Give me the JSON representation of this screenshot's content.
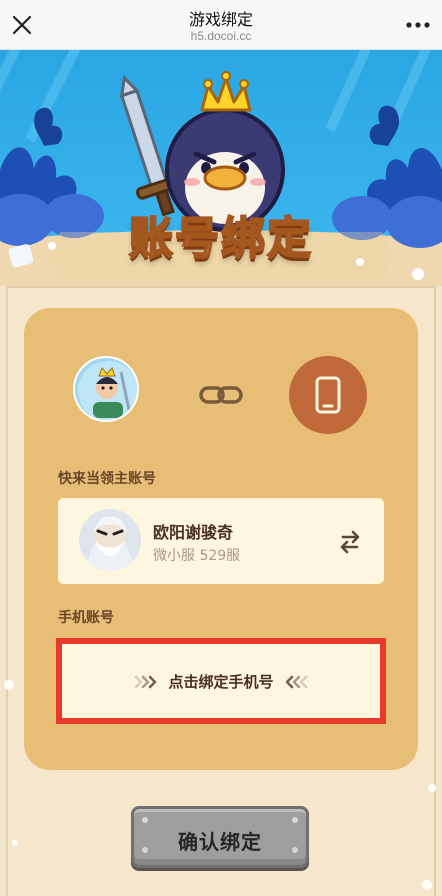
{
  "navbar": {
    "title": "游戏绑定",
    "subtitle": "h5.docoi.cc",
    "close_icon": "close-icon",
    "more_icon": "more-dots-icon"
  },
  "hero": {
    "title": "账号绑定"
  },
  "bind_panel": {
    "lord_label": "快来当领主账号",
    "account": {
      "name": "欧阳谢骏奇",
      "server": "微小服 529服"
    },
    "phone_label": "手机账号",
    "bind_phone_button": "点击绑定手机号"
  },
  "confirm_button": "确认绑定",
  "colors": {
    "card": "#e8bd76",
    "parchment": "#f6e7cc",
    "phone_circle": "#c0693a",
    "highlight_border": "#e8392c",
    "button_disabled": "#9e9e9e"
  }
}
